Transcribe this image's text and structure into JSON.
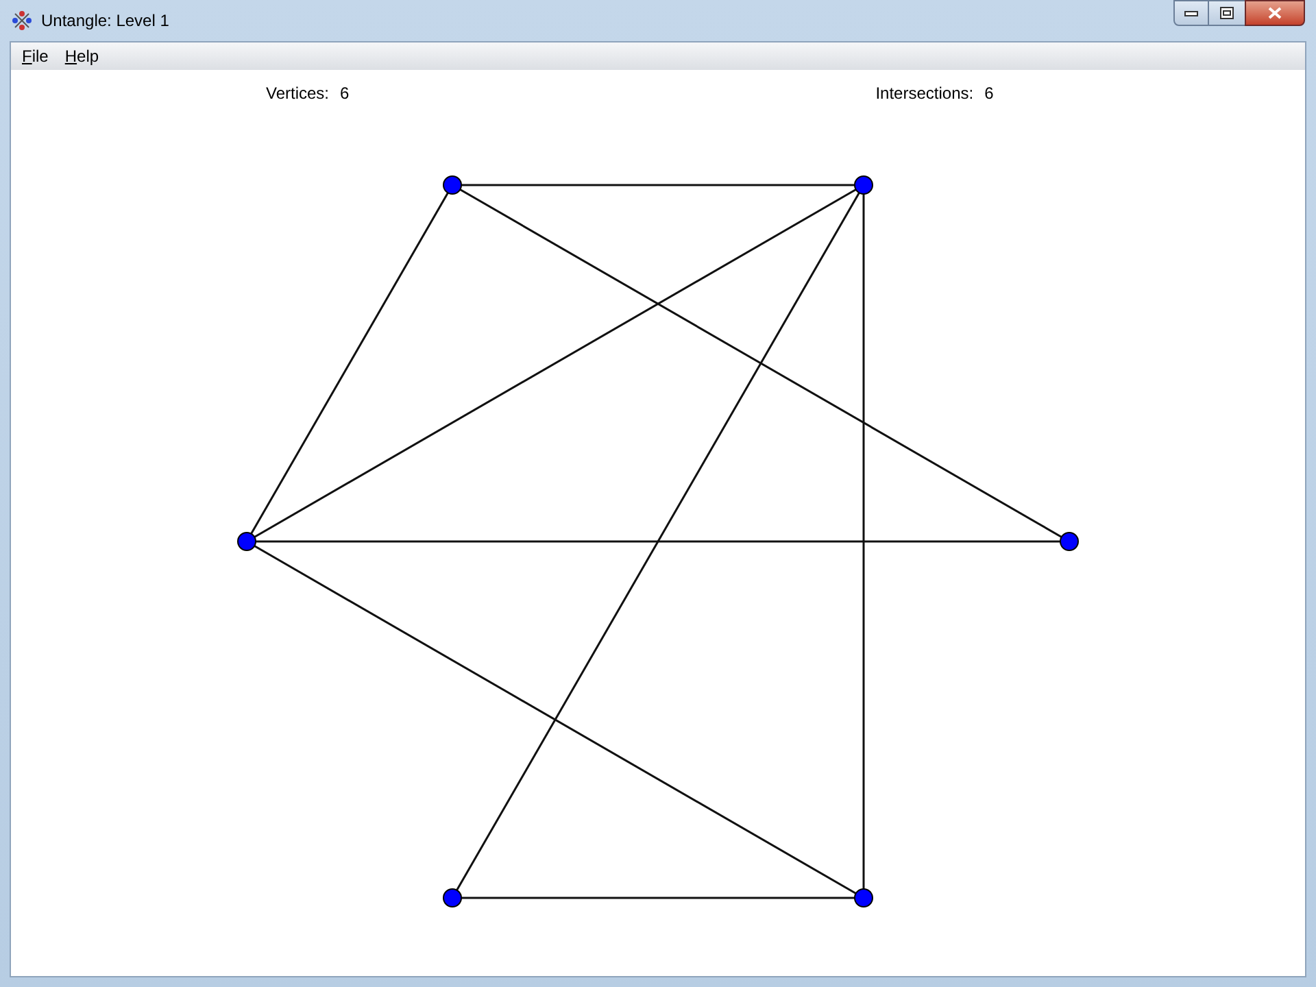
{
  "window": {
    "title": "Untangle: Level 1"
  },
  "menu": [
    {
      "key": "F",
      "rest": "ile"
    },
    {
      "key": "H",
      "rest": "elp"
    }
  ],
  "stats": [
    {
      "label": "Vertices:",
      "value": "6"
    },
    {
      "label": "Intersections:",
      "value": "6"
    }
  ]
}
